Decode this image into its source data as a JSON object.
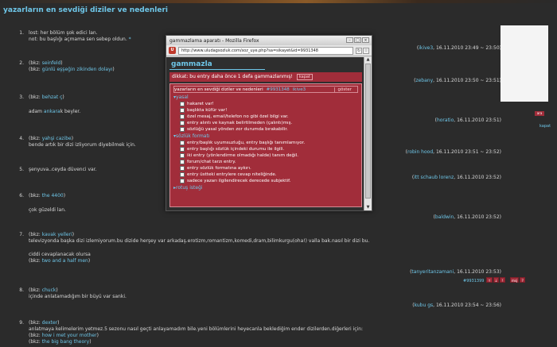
{
  "page": {
    "title": "yazarların en sevdiği diziler ve nedenleri"
  },
  "entries": [
    {
      "num": "1.",
      "lines": [
        "lost: her bölüm şok edici lan.",
        "not: bu başlığı açmama sen sebep oldun."
      ],
      "star": "*",
      "author": "ikive3",
      "date": "16.11.2010 23:49 ~ 23:50)"
    },
    {
      "num": "2.",
      "bkz1_pre": "(bkz: ",
      "bkz1": "seinfeld",
      "bkz1_post": ")",
      "bkz2_pre": "(bkz: ",
      "bkz2": "günlü eşşeğin zikinden dolayı",
      "bkz2_post": ")",
      "author": "zebany",
      "date": "16.11.2010 23:50 ~ 23:51)"
    },
    {
      "num": "3.",
      "bkz1_pre": "(bkz: ",
      "bkz1": "behzat ç",
      "bkz1_post": ")",
      "text_pre": "adam ",
      "text_link": "ankara",
      "text_post": "k beyler.",
      "author": "horatio",
      "date": "16.11.2010 23:51)"
    },
    {
      "num": "4.",
      "bkz1_pre": "(bkz: ",
      "bkz1": "yahşi cazibe",
      "bkz1_post": ")",
      "text": "bende artık bir dizi izliyorum diyebilmek için.",
      "author": "robin hood",
      "date": "16.11.2010 23:51 ~ 23:52)"
    },
    {
      "num": "5.",
      "text": "şenyuva..ceyda düvenci var.",
      "author": "itt schaub lorenz",
      "date": "16.11.2010 23:52)"
    },
    {
      "num": "6.",
      "bkz1_pre": "(bkz: ",
      "bkz1": "the 4400",
      "bkz1_post": ")",
      "text": "çok güzeldi lan.",
      "author": "baldwin",
      "date": "16.11.2010 23:52)"
    },
    {
      "num": "7.",
      "bkz1_pre": "(bkz: ",
      "bkz1": "kavak yelleri",
      "bkz1_post": ")",
      "text": "televizyonda başka dizi izlemiyorum.bu dizide herşey var arkadaş.erotizm,romantizm,komedi,dram,bilimkurgu(oha!) valla bak.nasıl bir dizi bu.",
      "text2": "ciddi cevaplanacak olursa",
      "bkz2_pre": "(bkz: ",
      "bkz2": "two and a half men",
      "bkz2_post": ")",
      "author": "tanyeritanzamani",
      "date": "16.11.2010 23:53)"
    },
    {
      "num": "8.",
      "bkz1_pre": "(bkz: ",
      "bkz1": "chuck",
      "bkz1_post": ")",
      "text": "içinde anlatamadığım bir büyü var sanki.",
      "author": "kubu gs",
      "date": "16.11.2010 23:54 ~ 23:56)"
    },
    {
      "num": "9.",
      "bkz1_pre": "(bkz: ",
      "bkz1": "dexter",
      "bkz1_post": ")",
      "text": "anlatmaya kelimelerim yetmez.5 sezonu nasıl geçti anlayamadım bile.yeni bölümlerini heyecanla beklediğim ender dizilerden.diğerleri için:",
      "bkz2_pre": "(bkz: ",
      "bkz2": "how i met your mother",
      "bkz2_post": ")",
      "bkz3_pre": "(bkz: ",
      "bkz3": "the big bang theory",
      "bkz3_post": ")"
    }
  ],
  "entry_tools": {
    "entry_id": "#9931399",
    "btn1": "↑",
    "btn2": "↓",
    "btn3": "!",
    "btn4": "msj",
    "btn5": "?"
  },
  "sidebar": {
    "ad_button": "ara",
    "ad_link": "kapat"
  },
  "popup": {
    "window_title": "gammazlama aparatı - Mozilla Firefox",
    "url": "http://www.uludagsozluk.com/soz_uye.php?sa=sikayet&id=9931348",
    "heading": "gammazla",
    "notice": "dikkat: bu entry daha önce 1 defa gammazlanmış!",
    "notice_btn": "kapat",
    "info_title": "yazarların en sevdiği diziler ve nedenleri",
    "info_id": "#9931348",
    "info_author": "ikive3",
    "info_btn": "göster",
    "cat1": "yasal",
    "cat1_opts": [
      "hakaret var!",
      "başlıkta küfür var!",
      "özel mesaj, email/telefon no gibi özel bilgi var.",
      "entry alıntı ve kaynak belirtilmeden (çalıntı)mış.",
      "sözlüğü yasal yönden zor durumda bırakabilir."
    ],
    "cat2": "sözlük formatı",
    "cat2_opts": [
      "entry/başlık uyumsuzluğu, entry başlığı tanımlamıyor.",
      "entry başlığı sözlük içindeki durumu ile ilgili.",
      "iki entry (yönlendirme olmadığı halde) tanım değil.",
      "forum/chat tarzı entry.",
      "entry sözlük formatına aykırı.",
      "entry üstteki entrylere cevap niteliğinde.",
      "sadece yazarı ilgilendirecek derecede subjektif."
    ],
    "cat3": "rotuş isteği"
  }
}
